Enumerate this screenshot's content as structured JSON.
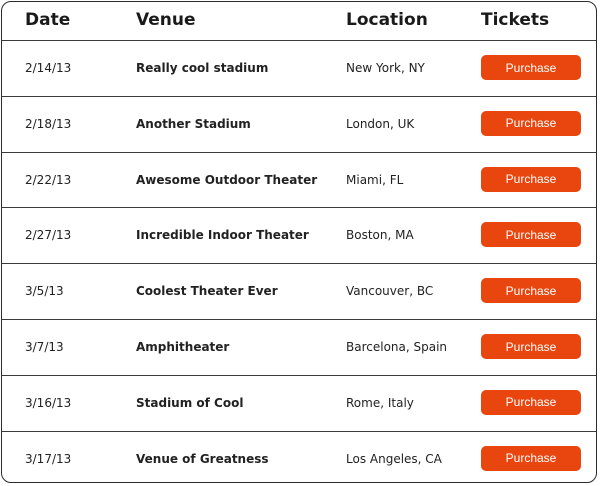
{
  "header": {
    "date": "Date",
    "venue": "Venue",
    "location": "Location",
    "tickets": "Tickets"
  },
  "rows": [
    {
      "date": "2/14/13",
      "venue": "Really cool stadium",
      "location": "New York, NY",
      "button": "Purchase"
    },
    {
      "date": "2/18/13",
      "venue": "Another Stadium",
      "location": "London, UK",
      "button": "Purchase"
    },
    {
      "date": "2/22/13",
      "venue": "Awesome Outdoor Theater",
      "location": "Miami, FL",
      "button": "Purchase"
    },
    {
      "date": "2/27/13",
      "venue": "Incredible Indoor Theater",
      "location": "Boston, MA",
      "button": "Purchase"
    },
    {
      "date": "3/5/13",
      "venue": "Coolest Theater Ever",
      "location": "Vancouver, BC",
      "button": "Purchase"
    },
    {
      "date": "3/7/13",
      "venue": "Amphitheater",
      "location": "Barcelona, Spain",
      "button": "Purchase"
    },
    {
      "date": "3/16/13",
      "venue": "Stadium of Cool",
      "location": "Rome, Italy",
      "button": "Purchase"
    },
    {
      "date": "3/17/13",
      "venue": "Venue of Greatness",
      "location": "Los Angeles, CA",
      "button": "Purchase"
    }
  ],
  "colors": {
    "accent": "#e8460e",
    "border": "#3a3a3a"
  }
}
